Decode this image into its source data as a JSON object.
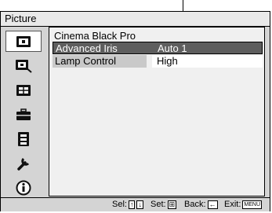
{
  "title": "Picture",
  "picture_mode": "Cinema Black Pro",
  "rows": [
    {
      "label": "Advanced Iris",
      "value": "Auto 1"
    },
    {
      "label": "Lamp Control",
      "value": "High"
    }
  ],
  "sidebar": {
    "items": [
      {
        "icon": "picture-icon"
      },
      {
        "icon": "picture-adjust-icon"
      },
      {
        "icon": "screen-icon"
      },
      {
        "icon": "setup-icon"
      },
      {
        "icon": "function-icon"
      },
      {
        "icon": "installation-icon"
      },
      {
        "icon": "information-icon"
      }
    ]
  },
  "status": {
    "sel_label": "Sel:",
    "set_label": "Set:",
    "back_label": "Back:",
    "exit_label": "Exit:",
    "menu_key": "MENU"
  },
  "colors": {
    "highlight": "#5e5e5e",
    "background": "#d4d4d4"
  }
}
